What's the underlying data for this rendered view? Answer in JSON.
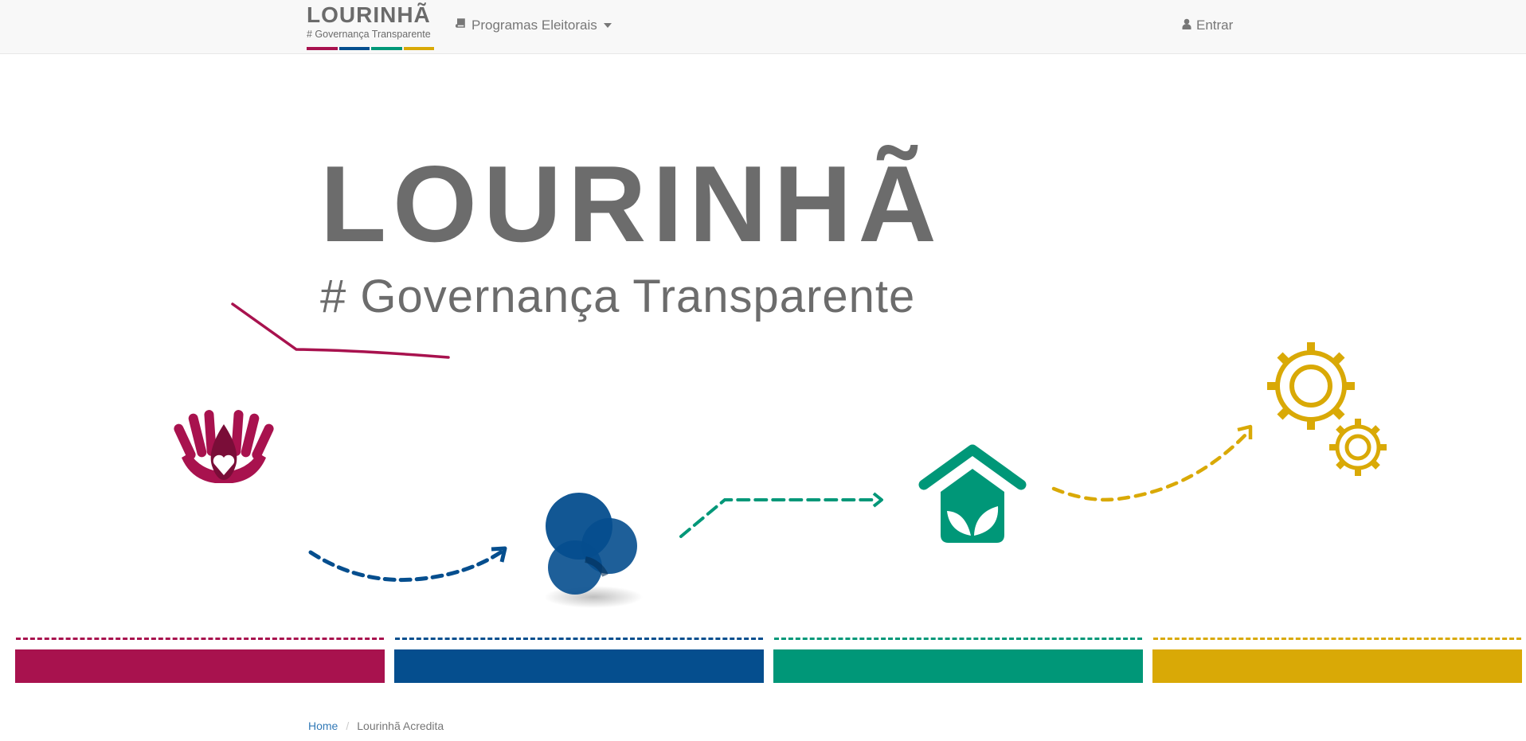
{
  "navbar": {
    "brand_name": "LOURINHÃ",
    "brand_tagline": "# Governança Transparente",
    "programas_label": "Programas Eleitorais",
    "login_label": "Entrar"
  },
  "hero": {
    "title": "LOURINHÃ",
    "subtitle": "# Governança Transparente"
  },
  "colors": {
    "magenta": "#a8124e",
    "blue": "#054e8e",
    "green": "#009778",
    "yellow": "#d9a906",
    "gray": "#6c6c6c"
  },
  "icons": [
    "book-icon",
    "user-icon",
    "hands-heart-icon",
    "circles-icon",
    "eco-house-icon",
    "gears-icon"
  ],
  "breadcrumb": {
    "home": "Home",
    "current": "Lourinhã Acredita"
  }
}
